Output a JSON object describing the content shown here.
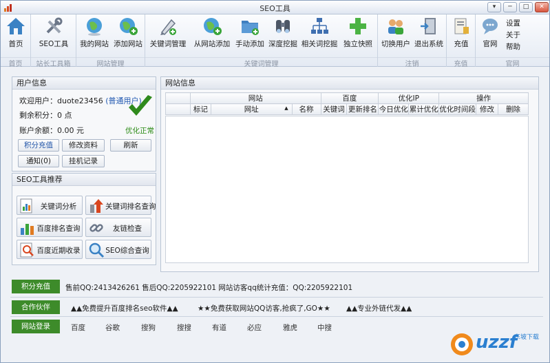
{
  "window": {
    "title": "SEO工具"
  },
  "window_buttons": {
    "menu": "▾",
    "minimize": "─",
    "maximize": "□",
    "close": "✕"
  },
  "ribbon": {
    "groups": [
      {
        "title": "首页",
        "buttons": [
          {
            "label": "首页",
            "icon": "home-icon"
          }
        ]
      },
      {
        "title": "站长工具箱",
        "buttons": [
          {
            "label": "SEO工具",
            "icon": "tools-icon"
          }
        ]
      },
      {
        "title": "网站管理",
        "buttons": [
          {
            "label": "我的网站",
            "icon": "globe-icon"
          },
          {
            "label": "添加网站",
            "icon": "globe-add-icon"
          }
        ]
      },
      {
        "title": "关键词管理",
        "buttons": [
          {
            "label": "关键词管理",
            "icon": "pen-icon"
          },
          {
            "label": "从网站添加",
            "icon": "globe-add-icon"
          },
          {
            "label": "手动添加",
            "icon": "folder-add-icon"
          },
          {
            "label": "深度挖掘",
            "icon": "binoculars-icon"
          },
          {
            "label": "相关词挖掘",
            "icon": "sitemap-icon"
          },
          {
            "label": "独立快照",
            "icon": "plus-green-icon"
          }
        ]
      },
      {
        "title": "注销",
        "buttons": [
          {
            "label": "切换用户",
            "icon": "users-icon"
          },
          {
            "label": "退出系统",
            "icon": "exit-icon"
          }
        ]
      },
      {
        "title": "充值",
        "buttons": [
          {
            "label": "充值",
            "icon": "recharge-icon"
          }
        ]
      },
      {
        "title": "官网",
        "buttons": [
          {
            "label": "官网",
            "icon": "chat-icon"
          }
        ]
      }
    ],
    "side": {
      "settings": "设置",
      "about": "关于",
      "help": "帮助"
    }
  },
  "user_panel": {
    "title": "用户信息",
    "welcome_label": "欢迎用户：",
    "username": "duote23456",
    "role": "(普通用户)",
    "points": "剩余积分：0 点",
    "balance": "账户余额：0.00 元",
    "status": "优化正常",
    "buttons": {
      "recharge": "积分充值",
      "edit": "修改资料",
      "refresh": "刷新",
      "notify": "通知(0)",
      "hang_log": "挂机记录"
    }
  },
  "seo_tools": {
    "title": "SEO工具推荐",
    "items": [
      "关键词分析",
      "关键词排名查询",
      "百度排名查询",
      "友链检查",
      "百度近期收录",
      "SEO综合查询"
    ]
  },
  "site_panel": {
    "title": "网站信息",
    "group_headers": [
      "网站",
      "百度",
      "优化IP",
      "操作"
    ],
    "columns": [
      "标记",
      "网址",
      "名称",
      "关键词",
      "更新排名",
      "今日优化",
      "累计优化",
      "优化时间段",
      "修改",
      "删除"
    ],
    "sort_indicator": "▲"
  },
  "bottom": {
    "recharge": {
      "tag": "积分充值",
      "text": "售前QQ:2413426261  售后QQ:2205922101  网站访客qq统计充值：QQ:2205922101"
    },
    "partners": {
      "tag": "合作伙伴",
      "items": [
        "▲▲免费提升百度排名seo软件▲▲",
        "★★免费获取网站QQ访客,抢疯了,GO★★",
        "▲▲专业外链代发▲▲"
      ]
    },
    "login": {
      "tag": "网站登录",
      "items": [
        "百度",
        "谷歌",
        "搜狗",
        "搜搜",
        "有道",
        "必应",
        "雅虎",
        "中搜"
      ]
    }
  },
  "watermark": {
    "text": "uzzf",
    "sub": "东坡下载"
  },
  "colors": {
    "accent_green": "#3d8b2a",
    "link_blue": "#1f56b0",
    "border": "#b8c4d4"
  }
}
